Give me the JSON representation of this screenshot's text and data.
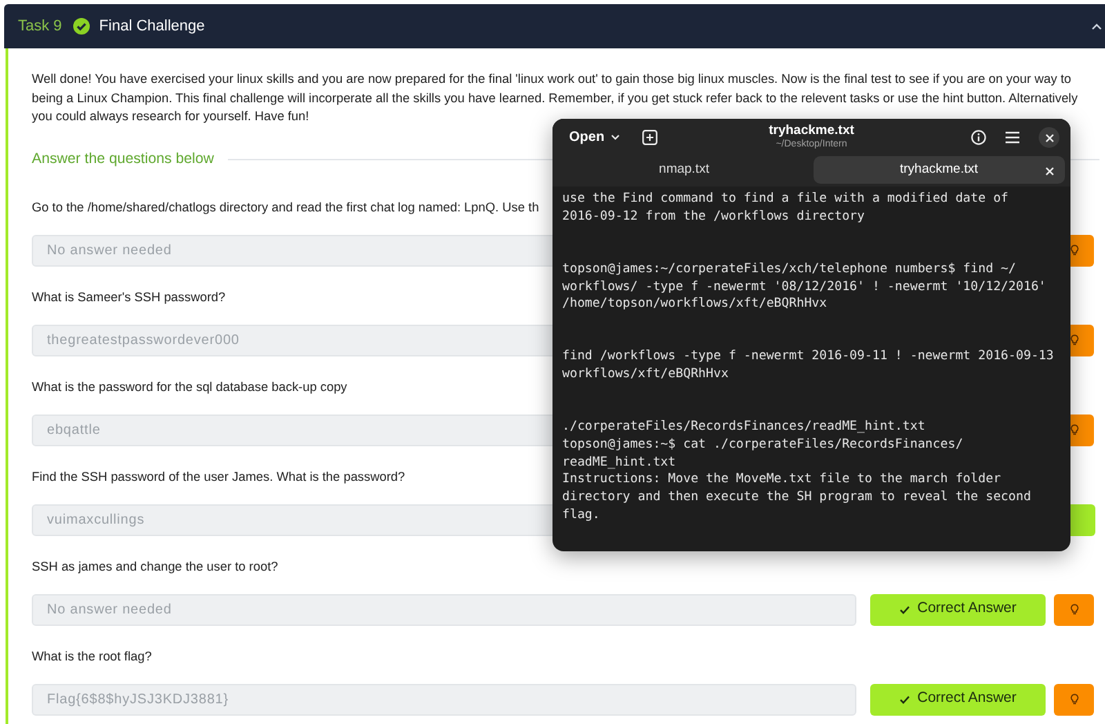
{
  "task": {
    "number": "Task 9",
    "completed": true,
    "title": "Final Challenge"
  },
  "intro": "Well done! You have exercised your linux skills and you are now prepared for the final 'linux work out' to gain those big linux muscles. Now is the final test to see if you are on your way to being a Linux Champion. This final challenge will incorperate all the skills you have learned. Remember, if you get stuck refer back to the relevent tasks or use the hint button. Alternatively you could always research for yourself. Have fun!",
  "section_heading": "Answer the questions below",
  "questions": [
    {
      "text": "Go to the /home/shared/chatlogs directory and read the first chat log named: LpnQ. Use th",
      "answer": "No answer needed",
      "hint": true
    },
    {
      "text": "What is Sameer's SSH password?",
      "answer": "thegreatestpasswordever000",
      "hint": true
    },
    {
      "text": "What is the password for the sql database back-up copy",
      "answer": "ebqattle",
      "hint": true
    },
    {
      "text": "Find the SSH password of the user James. What is the password?",
      "answer": "vuimaxcullings",
      "hint": false
    },
    {
      "text": "SSH as james and change the user to root?",
      "answer": "No answer needed",
      "hint": true,
      "button": "Correct Answer"
    },
    {
      "text": "What is the root flag?",
      "answer": "Flag{6$8$hyJSJ3KDJ3881}",
      "hint": true,
      "button": "Correct Answer"
    }
  ],
  "editor": {
    "open_label": "Open",
    "title": "tryhackme.txt",
    "path": "~/Desktop/Intern",
    "tabs": [
      {
        "label": "nmap.txt",
        "selected": false
      },
      {
        "label": "tryhackme.txt",
        "selected": true
      }
    ],
    "paragraphs": [
      [
        "use the Find command to find a file with a modified date of",
        "2016-09-12 from the /workflows directory"
      ],
      [
        "topson@james:~/corperateFiles/xch/telephone numbers$ find ~/",
        "workflows/ -type f -newermt '08/12/2016' ! -newermt '10/12/2016'",
        "/home/topson/workflows/xft/eBQRhHvx"
      ],
      [
        "find /workflows -type f -newermt 2016-09-11 ! -newermt 2016-09-13",
        "workflows/xft/eBQRhHvx"
      ],
      [
        "./corperateFiles/RecordsFinances/readME_hint.txt",
        "topson@james:~$ cat ./corperateFiles/RecordsFinances/",
        "readME_hint.txt",
        "Instructions: Move the MoveMe.txt file to the march folder",
        "directory and then execute the SH program to reveal the second",
        "flag."
      ]
    ]
  }
}
